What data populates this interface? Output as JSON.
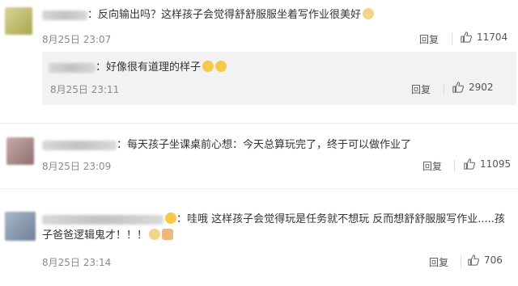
{
  "comments": [
    {
      "text": "：反向输出吗？这样孩子会觉得舒舒服服坐着写作业很美好",
      "time": "8月25日 23:07",
      "reply": "回复",
      "likes": "11704",
      "sub": {
        "text": "：好像很有道理的样子",
        "time": "8月25日 23:11",
        "reply": "回复",
        "likes": "2902"
      }
    },
    {
      "text": "：每天孩子坐课桌前心想：今天总算玩完了，终于可以做作业了",
      "time": "8月25日 23:09",
      "reply": "回复",
      "likes": "11095"
    },
    {
      "text_line1": "：哇哦 这样孩子会觉得玩是任务就不想玩 反而想舒舒服服写作业.....孩",
      "text_line2": "子爸爸逻辑鬼才！！！",
      "time": "8月25日 23:14",
      "reply": "回复",
      "likes": "706"
    }
  ]
}
